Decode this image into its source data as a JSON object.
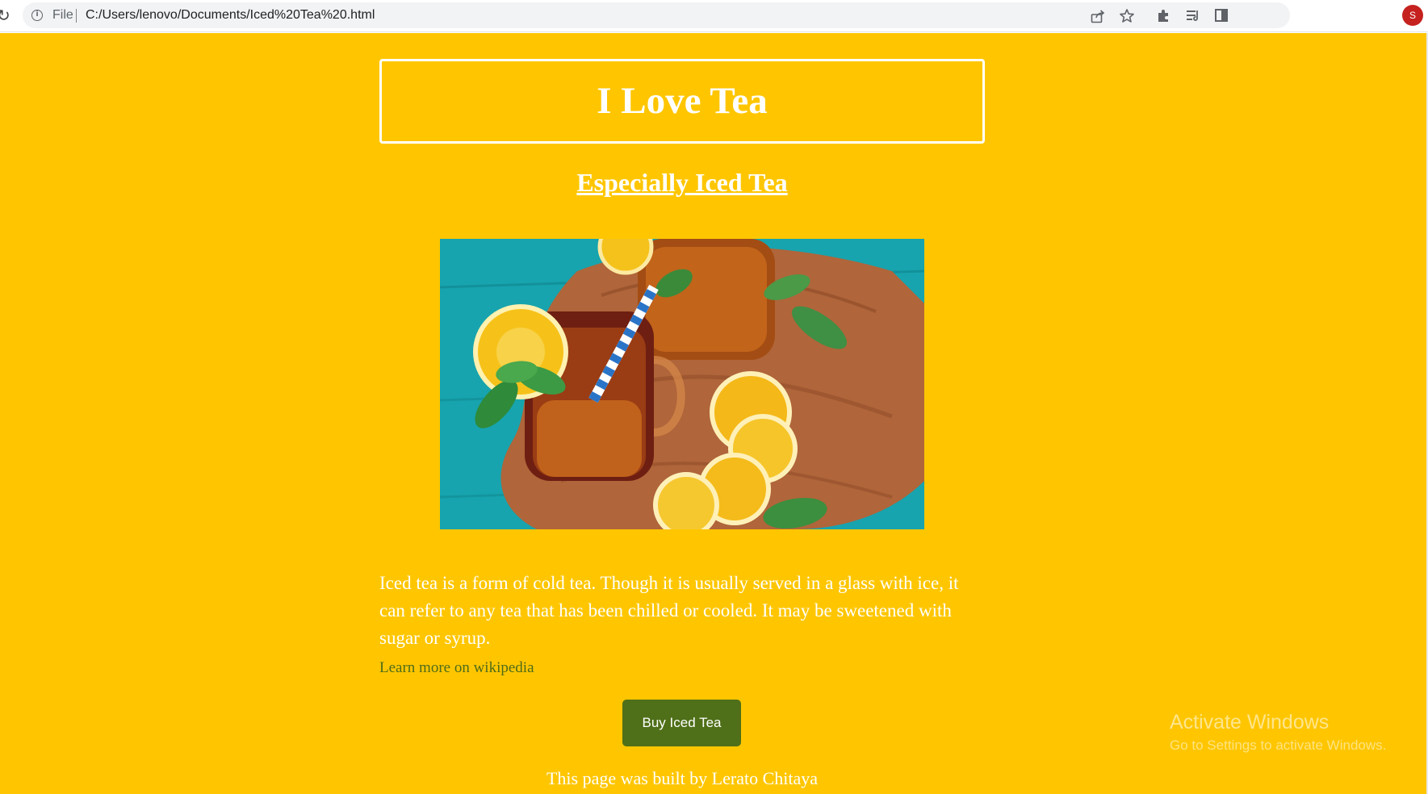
{
  "browser": {
    "scheme_label": "File",
    "url": "C:/Users/lenovo/Documents/Iced%20Tea%20.html",
    "avatar_initial": "S",
    "icons": [
      "reload-icon",
      "info-icon",
      "share-icon",
      "bookmark-star-icon",
      "extensions-icon",
      "reading-list-icon",
      "side-panel-icon"
    ],
    "colors": {
      "omnibox_bg": "#f1f3f4",
      "avatar_bg": "#c5221f"
    }
  },
  "page": {
    "colors": {
      "background": "#ffc600",
      "text": "#ffffff",
      "link": "#4f6b19",
      "button": "#4f6f18"
    },
    "title": "I Love Tea",
    "subtitle": "Especially Iced Tea",
    "description": "Iced tea is a form of cold tea. Though it is usually served in a glass with ice, it can refer to any tea that has been chilled or cooled. It may be sweetened with sugar or syrup.",
    "link_text": "Learn more on wikipedia",
    "button_label": "Buy Iced Tea",
    "footer": "This page was built by Lerato Chitaya"
  },
  "watermark": {
    "title": "Activate Windows",
    "subtitle": "Go to Settings to activate Windows."
  }
}
